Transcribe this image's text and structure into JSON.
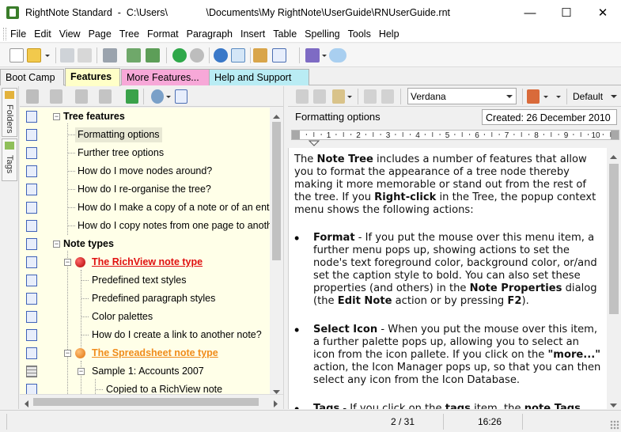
{
  "window": {
    "title": "RightNote Standard  -  C:\\Users\\              \\Documents\\My RightNote\\UserGuide\\RNUserGuide.rnt",
    "minimize": "—",
    "maximize": "☐",
    "close": "✕"
  },
  "menu": [
    "File",
    "Edit",
    "View",
    "Page",
    "Tree",
    "Format",
    "Paragraph",
    "Insert",
    "Table",
    "Spelling",
    "Tools",
    "Help"
  ],
  "tabs": [
    {
      "label": "Boot Camp",
      "color": "#f0f0f0"
    },
    {
      "label": "Features",
      "color": "#ffffc8",
      "active": true
    },
    {
      "label": "More Features...",
      "color": "#f7a8d8"
    },
    {
      "label": "Help and Support",
      "color": "#b9ecf4"
    }
  ],
  "sidebar_tabs": [
    "Folders",
    "Tags"
  ],
  "tree": {
    "nodes": [
      {
        "label": "Tree features",
        "bold": true
      },
      {
        "label": "Formatting options",
        "selected": true
      },
      {
        "label": "Further tree options"
      },
      {
        "label": "How do I move nodes around?"
      },
      {
        "label": "How do I re-organise the tree?"
      },
      {
        "label": "How do I make a copy of a note or of an entire"
      },
      {
        "label": "How do I copy notes from one page to anothe"
      },
      {
        "label": "Note types",
        "bold": true
      },
      {
        "label": "The RichView note type",
        "color": "#e01010"
      },
      {
        "label": "Predefined text styles"
      },
      {
        "label": "Predefined paragraph styles"
      },
      {
        "label": "Color palettes"
      },
      {
        "label": "How do I create a link to another note?"
      },
      {
        "label": "The Spreadsheet note type",
        "color": "#f08c1c"
      },
      {
        "label": "Sample 1: Accounts 2007"
      },
      {
        "label": "Copied to a RichView note"
      }
    ]
  },
  "editor": {
    "font_name": "Verdana",
    "style_name": "Default",
    "note_title": "Formatting options",
    "created": "Created: 26 December 2010",
    "ruler_labels": [
      "1",
      "2",
      "3",
      "4",
      "5",
      "6",
      "7",
      "8",
      "9",
      "10",
      "1"
    ],
    "intro": {
      "t1": "The ",
      "b1": "Note Tree",
      "t2": " includes a number of features that allow you to format the appearance of a tree node thereby making it more memorable or stand out from the rest of the tree. If you ",
      "b2": "Right-click",
      "t3": " in the Tree, the popup context menu shows the following actions:"
    },
    "bullet1": {
      "b1": "Format",
      "t1": " - If you put the mouse over this menu item, a further menu pops up, showing actions to set the node's text foreground color, background color, or/and set the caption style to bold. You can also set these properties (and others) in the ",
      "b2": "Note Properties",
      "t2": " dialog (the ",
      "b3": "Edit Note",
      "t3": " action or by pressing ",
      "b4": "F2",
      "t4": ")."
    },
    "bullet2": {
      "b1": "Select Icon",
      "t1": " - When you put the mouse over this item, a further palette pops up, allowing you to select an icon from the icon pallete. If you click on the ",
      "b2": "\"more...\"",
      "t2": " action, the Icon Manager pops up, so that you can then select any icon from the Icon Database."
    },
    "bullet3": {
      "b1": "Tags",
      "t1": " - If you click on the ",
      "b2": "tags",
      "t2": " item, the ",
      "b3": "note Tags"
    }
  },
  "status": {
    "position": "2 / 31",
    "time": "16:26"
  }
}
